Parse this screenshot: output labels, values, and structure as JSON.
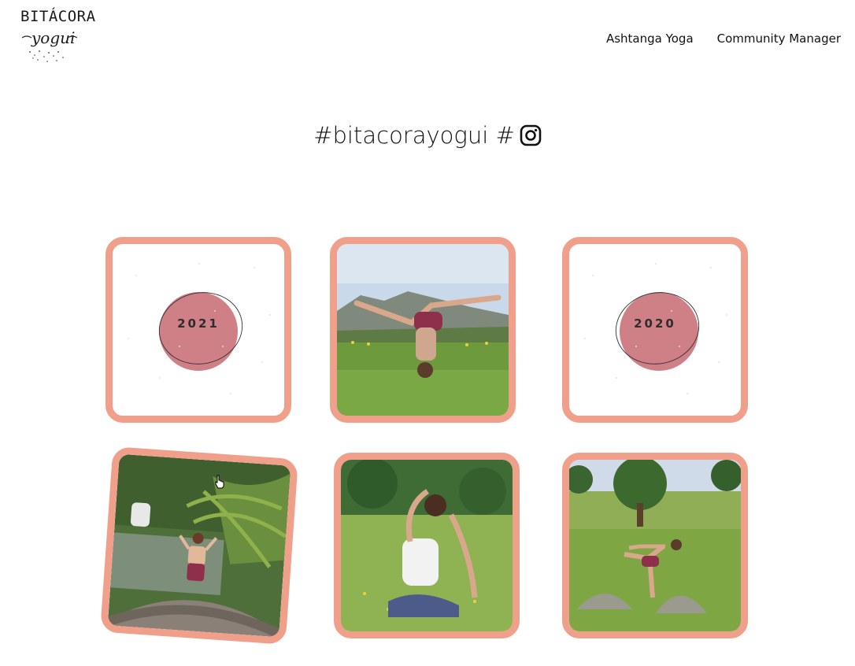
{
  "logo": {
    "line1": "BITÁCORA",
    "line2": "yogui"
  },
  "nav": {
    "items": [
      {
        "label": "Ashtanga Yoga"
      },
      {
        "label": "Community Manager"
      }
    ]
  },
  "heading": {
    "text": "#bitacorayogui #",
    "icon": "instagram-icon"
  },
  "grid": {
    "cards": [
      {
        "type": "year-badge",
        "label": "2021"
      },
      {
        "type": "photo",
        "icon": "yoga-headstand-photo"
      },
      {
        "type": "year-badge",
        "label": "2020"
      },
      {
        "type": "photo",
        "icon": "yoga-bridge-photo"
      },
      {
        "type": "photo",
        "icon": "yoga-pigeon-pose-photo"
      },
      {
        "type": "photo",
        "icon": "yoga-dancer-pose-photo"
      }
    ]
  },
  "colors": {
    "card_border": "#f0a08a",
    "badge": "#cf7f86",
    "text": "#111111"
  }
}
